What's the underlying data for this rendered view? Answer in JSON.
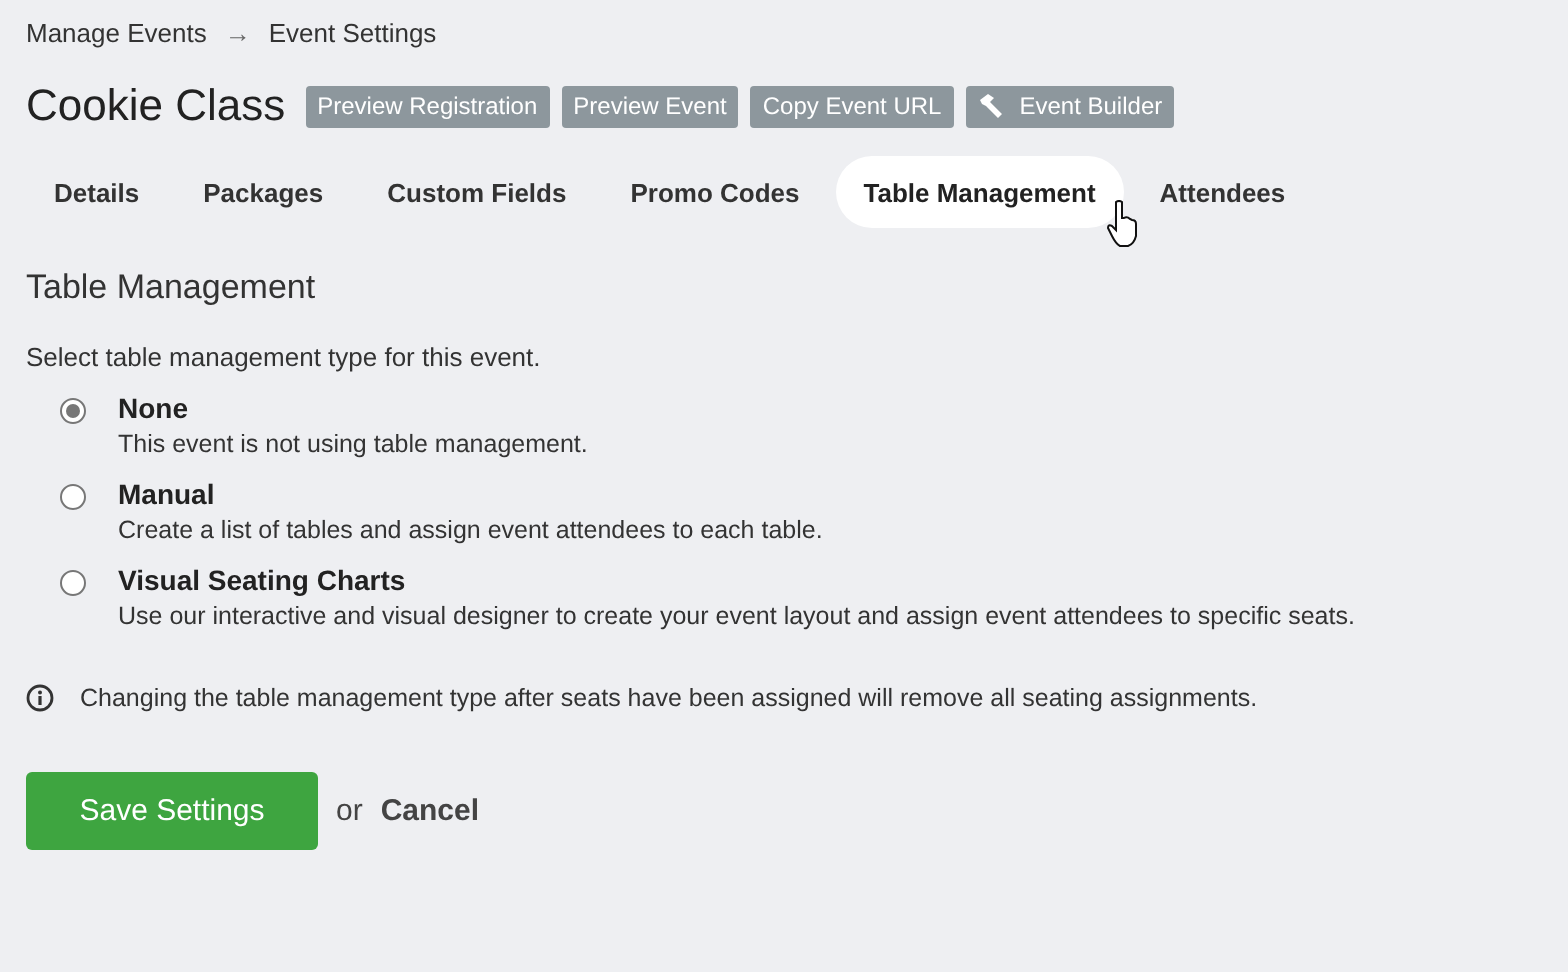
{
  "breadcrumb": {
    "parent": "Manage Events",
    "separator": "→",
    "current": "Event Settings"
  },
  "title": "Cookie Class",
  "header_buttons": [
    {
      "label": "Preview Registration",
      "kind": "plain"
    },
    {
      "label": "Preview Event",
      "kind": "plain"
    },
    {
      "label": "Copy Event URL",
      "kind": "plain"
    },
    {
      "label": "Event Builder",
      "kind": "hammer"
    }
  ],
  "tabs": [
    {
      "label": "Details",
      "selected": false
    },
    {
      "label": "Packages",
      "selected": false
    },
    {
      "label": "Custom Fields",
      "selected": false
    },
    {
      "label": "Promo Codes",
      "selected": false
    },
    {
      "label": "Table Management",
      "selected": true
    },
    {
      "label": "Attendees",
      "selected": false
    }
  ],
  "section_title": "Table Management",
  "prompt": "Select table management type for this event.",
  "options": [
    {
      "label": "None",
      "description": "This event is not using table management.",
      "selected": true
    },
    {
      "label": "Manual",
      "description": "Create a list of tables and assign event attendees to each table.",
      "selected": false
    },
    {
      "label": "Visual Seating Charts",
      "description": "Use our interactive and visual designer to create your event layout and assign event attendees to specific seats.",
      "selected": false
    }
  ],
  "note": "Changing the table management type after seats have been assigned will remove all seating assignments.",
  "save_button": "Save Settings",
  "or_text": "or",
  "cancel_link": "Cancel"
}
